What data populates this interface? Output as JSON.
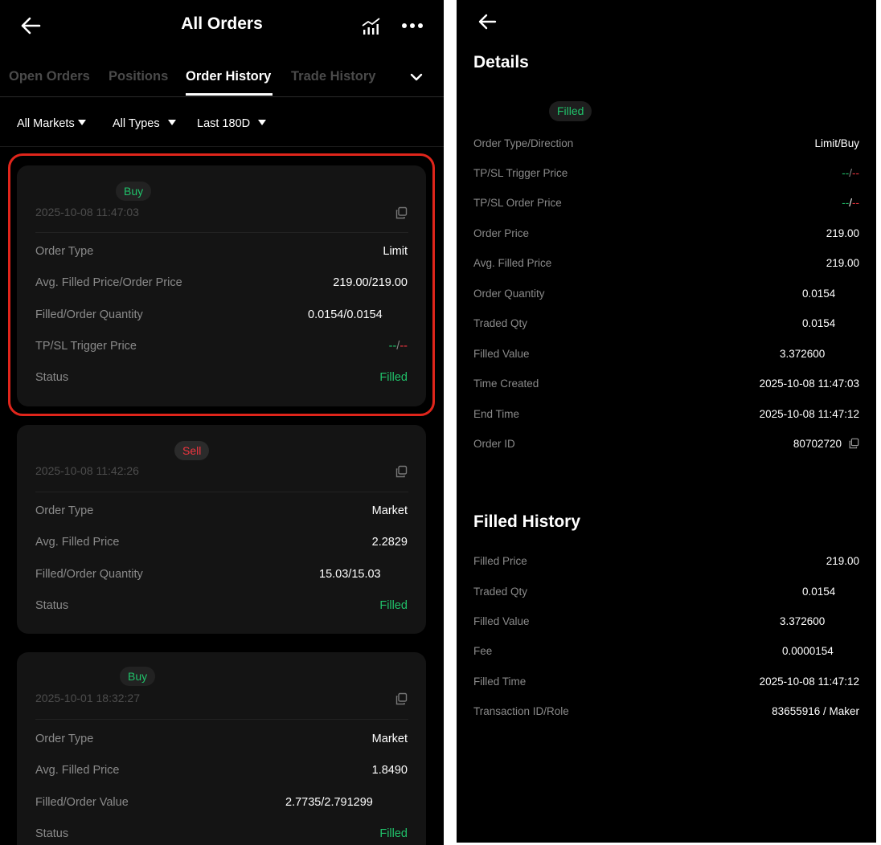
{
  "left": {
    "title": "All Orders",
    "tabs": [
      "Open Orders",
      "Positions",
      "Order History",
      "Trade History"
    ],
    "active_tab": "Order History",
    "filters": [
      "All Markets",
      "All Types",
      "Last 180D"
    ],
    "orders": [
      {
        "side": "Buy",
        "time": "2025-10-08 11:47:03",
        "rows": [
          {
            "label": "Order Type",
            "value": "Limit"
          },
          {
            "label": "Avg. Filled Price/Order Price",
            "value": "219.00/219.00"
          },
          {
            "label": "Filled/Order Quantity",
            "value": "0.0154/0.0154"
          },
          {
            "label": "TP/SL Trigger Price",
            "value_green": "--",
            "value_sep": "/",
            "value_red": "--"
          },
          {
            "label": "Status",
            "value": "Filled"
          }
        ]
      },
      {
        "side": "Sell",
        "time": "2025-10-08 11:42:26",
        "rows": [
          {
            "label": "Order Type",
            "value": "Market"
          },
          {
            "label": "Avg. Filled Price",
            "value": "2.2829"
          },
          {
            "label": "Filled/Order Quantity",
            "value": "15.03/15.03"
          },
          {
            "label": "Status",
            "value": "Filled"
          }
        ]
      },
      {
        "side": "Buy",
        "time": "2025-10-01 18:32:27",
        "rows": [
          {
            "label": "Order Type",
            "value": "Market"
          },
          {
            "label": "Avg. Filled Price",
            "value": "1.8490"
          },
          {
            "label": "Filled/Order Value",
            "value": "2.7735/2.791299"
          },
          {
            "label": "Status",
            "value": "Filled"
          }
        ]
      }
    ]
  },
  "right": {
    "details_title": "Details",
    "status": "Filled",
    "details": [
      {
        "label": "Order Type/Direction",
        "value": "Limit/Buy"
      },
      {
        "label": "TP/SL Trigger Price",
        "value_green": "--",
        "value_sep": "/",
        "value_red": "--"
      },
      {
        "label": "TP/SL Order Price",
        "value_green": "--",
        "value_sep": "/",
        "value_red": "--"
      },
      {
        "label": "Order Price",
        "value": "219.00"
      },
      {
        "label": "Avg. Filled Price",
        "value": "219.00"
      },
      {
        "label": "Order Quantity",
        "value": "0.0154"
      },
      {
        "label": "Traded Qty",
        "value": "0.0154"
      },
      {
        "label": "Filled Value",
        "value": "3.372600"
      },
      {
        "label": "Time Created",
        "value": "2025-10-08 11:47:03"
      },
      {
        "label": "End Time",
        "value": "2025-10-08 11:47:12"
      },
      {
        "label": "Order ID",
        "value": "80702720"
      }
    ],
    "history_title": "Filled History",
    "history": [
      {
        "label": "Filled Price",
        "value": "219.00"
      },
      {
        "label": "Traded Qty",
        "value": "0.0154"
      },
      {
        "label": "Filled Value",
        "value": "3.372600"
      },
      {
        "label": "Fee",
        "value": "0.0000154"
      },
      {
        "label": "Filled Time",
        "value": "2025-10-08 11:47:12"
      },
      {
        "label": "Transaction ID/Role",
        "value": "83655916 / Maker"
      }
    ]
  },
  "colors": {
    "background": "#000000",
    "card": "#141414",
    "buy_green": "#20c26a",
    "sell_red": "#f0353f",
    "highlight_red": "#e0251b",
    "muted_text": "#8a8a8a"
  },
  "icons": [
    "back-arrow-icon",
    "trend-chart-icon",
    "more-dots-icon",
    "chevron-down-icon",
    "copy-icon"
  ]
}
